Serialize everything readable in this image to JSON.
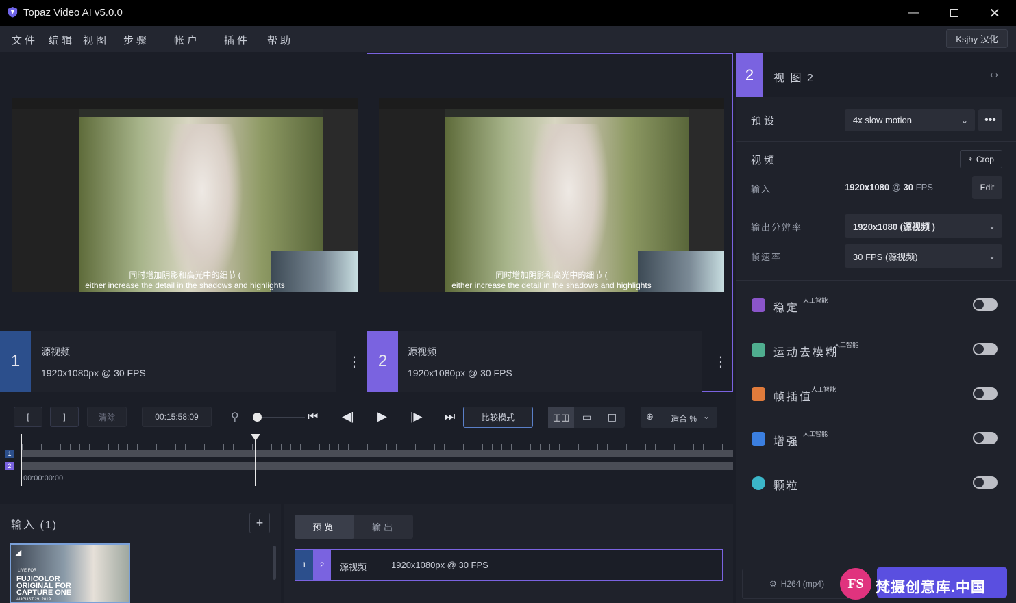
{
  "app": {
    "title": "Topaz Video AI  v5.0.0"
  },
  "menu": {
    "items": [
      "文件",
      "编辑",
      "视图",
      "步骤",
      "帐户",
      "插件",
      "帮助"
    ],
    "user": "Ksjhy 汉化"
  },
  "views": [
    {
      "number": "1",
      "name": "源视频",
      "info": "1920x1080px @ 30 FPS",
      "subtitle_cn": "同时增加阴影和高光中的细节 (",
      "subtitle_en": "either increase the detail in the shadows and highlights"
    },
    {
      "number": "2",
      "name": "源视频",
      "info": "1920x1080px @ 30 FPS",
      "subtitle_cn": "同时增加阴影和高光中的细节 (",
      "subtitle_en": "either increase the detail in the shadows and highlights"
    }
  ],
  "right_panel": {
    "view_number": "2",
    "view_title": "视 图 2",
    "preset_label": "预设",
    "preset_value": "4x slow motion",
    "video_label": "视频",
    "crop_label": "Crop",
    "input_label": "输入",
    "input_res": "1920x1080",
    "input_at": "@",
    "input_fps": "30",
    "input_fps_unit": "FPS",
    "edit_label": "Edit",
    "out_res_label": "输出分辨率",
    "out_res_value": "1920x1080 (源视频 )",
    "framerate_label": "帧速率",
    "framerate_value": "30 FPS (源视频)",
    "features": [
      {
        "label": "稳定",
        "tag": "人工智能",
        "on": false,
        "color": "#8a55c9"
      },
      {
        "label": "运动去模糊",
        "tag": "人工智能",
        "on": false,
        "color": "#4fae8f"
      },
      {
        "label": "帧插值",
        "tag": "人工智能",
        "on": false,
        "color": "#e07b3b"
      },
      {
        "label": "增强",
        "tag": "人工智能",
        "on": false,
        "color": "#3b7fe0"
      },
      {
        "label": "颗粒",
        "tag": "",
        "on": false,
        "color": "#3bb6c9"
      }
    ],
    "codec": "H264 (mp4)"
  },
  "controls": {
    "mark_in": "[",
    "mark_out": "]",
    "clear": "清除",
    "timecode": "00:15:58:09",
    "compare": "比较模式",
    "zoom_fit": "适合 %",
    "timeline_start": "00:00:00:00",
    "track_labels": [
      "1",
      "2"
    ]
  },
  "input_panel": {
    "title": "输入 (1)",
    "add": "+",
    "thumb_text": [
      "FUJICOLOR",
      "ORIGINAL FOR",
      "CAPTURE ONE",
      "AUGUST 29, 2019"
    ],
    "thumb_brand": "LIVE FOR"
  },
  "preview_panel": {
    "tabs": [
      "预览",
      "输出"
    ],
    "row": {
      "n1": "1",
      "n2": "2",
      "name": "源视频",
      "info": "1920x1080px @ 30 FPS"
    }
  },
  "watermark": {
    "logo": "FS",
    "text": "梵摄创意库.中国"
  },
  "colors": {
    "accent": "#7a63e0",
    "view1": "#2c4f8c",
    "bg": "#1b1e27",
    "panel": "#1f222b"
  }
}
